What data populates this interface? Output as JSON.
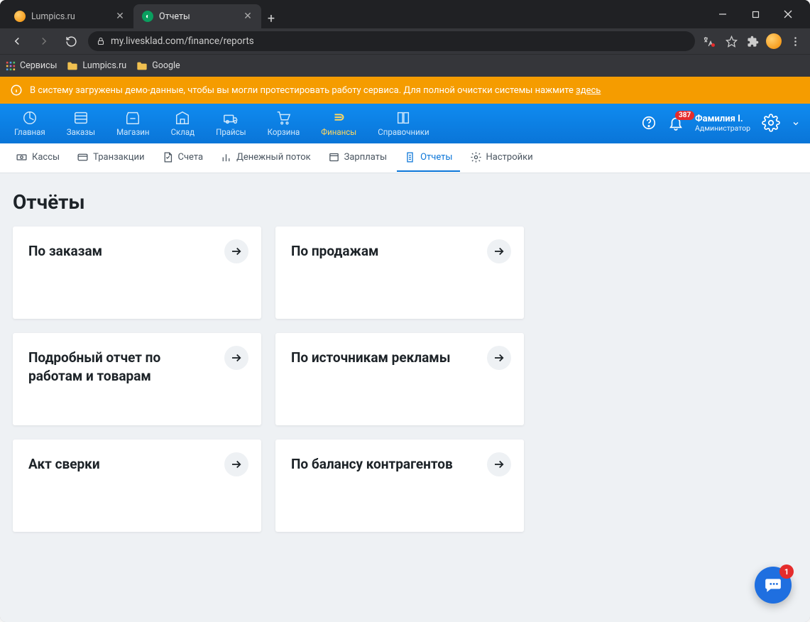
{
  "browser": {
    "tabs": [
      {
        "title": "Lumpics.ru",
        "active": false,
        "favicon_color": "#f28a00"
      },
      {
        "title": "Отчеты",
        "active": true,
        "favicon_color": "#0a9f5f"
      }
    ],
    "url": "my.livesklad.com/finance/reports",
    "bookmarks": [
      {
        "label": "Сервисы",
        "icon": "grid"
      },
      {
        "label": "Lumpics.ru",
        "icon": "folder"
      },
      {
        "label": "Google",
        "icon": "folder"
      }
    ]
  },
  "banner": {
    "text": "В систему загружены демо-данные, чтобы вы могли протестировать работу сервиса. Для полной очистки системы нажмите ",
    "link": "здесь"
  },
  "mainnav": {
    "items": [
      {
        "label": "Главная"
      },
      {
        "label": "Заказы"
      },
      {
        "label": "Магазин"
      },
      {
        "label": "Склад"
      },
      {
        "label": "Прайсы"
      },
      {
        "label": "Корзина"
      },
      {
        "label": "Финансы",
        "active": true
      },
      {
        "label": "Справочники"
      }
    ],
    "notification_count": "387",
    "user_name": "Фамилия I.",
    "user_role": "Администратор"
  },
  "subnav": {
    "items": [
      {
        "label": "Кассы"
      },
      {
        "label": "Транзакции"
      },
      {
        "label": "Счета"
      },
      {
        "label": "Денежный поток"
      },
      {
        "label": "Зарплаты"
      },
      {
        "label": "Отчеты",
        "active": true
      },
      {
        "label": "Настройки"
      }
    ]
  },
  "page": {
    "title": "Отчёты",
    "cards": [
      {
        "title": "По заказам"
      },
      {
        "title": "По продажам"
      },
      {
        "title": "Подробный отчет по работам и товарам"
      },
      {
        "title": "По источникам рекламы"
      },
      {
        "title": "Акт сверки"
      },
      {
        "title": "По балансу контрагентов"
      }
    ]
  },
  "chat_badge": "1"
}
